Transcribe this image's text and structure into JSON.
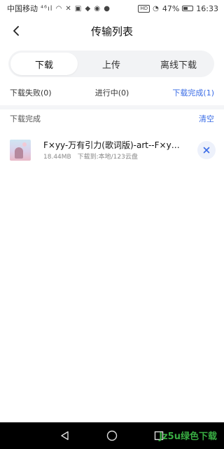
{
  "status_bar": {
    "carrier": "中国移动",
    "signal": "⁴⁶ıl",
    "battery": "47%",
    "time": "16:33"
  },
  "header": {
    "title": "传输列表"
  },
  "tabs": [
    {
      "label": "下载",
      "active": true
    },
    {
      "label": "上传",
      "active": false
    },
    {
      "label": "离线下载",
      "active": false
    }
  ],
  "filters": [
    {
      "label": "下载失败(0)",
      "active": false
    },
    {
      "label": "进行中(0)",
      "active": false
    },
    {
      "label": "下载完成(1)",
      "active": true
    }
  ],
  "section": {
    "title": "下载完成",
    "clear_label": "清空"
  },
  "files": [
    {
      "name": "F×yy-万有引力(歌词版)-art--F×yy--a...",
      "size": "18.44MB",
      "location": "下载到:本地/123云盘"
    }
  ],
  "watermark": "Jz5u绿色下载",
  "colors": {
    "accent": "#3a6ce6",
    "tab_bg": "#f2f3f5",
    "divider": "#f4f5f7",
    "nav_bar": "#000000"
  }
}
